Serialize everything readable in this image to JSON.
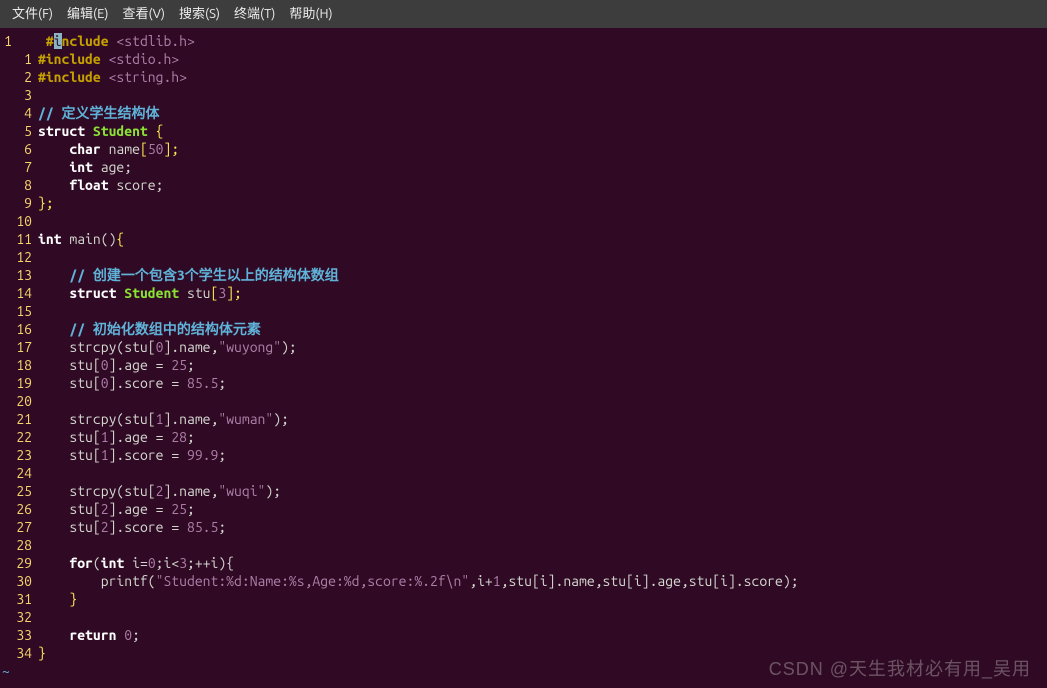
{
  "menu": {
    "file": "文件(F)",
    "edit": "编辑(E)",
    "view": "查看(V)",
    "search": "搜索(S)",
    "terminal": "终端(T)",
    "help": "帮助(H)"
  },
  "watermark": "CSDN @天生我材必有用_吴用",
  "linesCol1": [
    "1",
    "",
    "",
    "",
    "",
    "",
    "",
    "",
    "",
    "",
    "",
    "",
    "",
    "",
    "",
    "",
    "",
    "",
    "",
    "",
    "",
    "",
    "",
    "",
    "",
    "",
    "",
    "",
    "",
    "",
    "",
    "",
    "",
    "",
    ""
  ],
  "linesCol2": [
    "",
    "1",
    "2",
    "3",
    "4",
    "5",
    "6",
    "7",
    "8",
    "9",
    "10",
    "11",
    "12",
    "13",
    "14",
    "15",
    "16",
    "17",
    "18",
    "19",
    "20",
    "21",
    "22",
    "23",
    "24",
    "25",
    "26",
    "27",
    "28",
    "29",
    "30",
    "31",
    "32",
    "33",
    "34"
  ],
  "code": {
    "l0": {
      "pp1": "#",
      "cursor": "i",
      "pp2": "nclude",
      "inc": "<stdlib.h>"
    },
    "l1": {
      "pp": "#include",
      "inc": "<stdio.h>"
    },
    "l2": {
      "pp": "#include",
      "inc": "<string.h>"
    },
    "l4": {
      "cm": "// 定义学生结构体"
    },
    "l5": {
      "kw": "struct",
      "type": "Student",
      "br": "{"
    },
    "l6": {
      "kw": "char",
      "id": "name",
      "br1": "[",
      "num": "50",
      "br2": "];"
    },
    "l7": {
      "kw": "int",
      "id": "age;"
    },
    "l8": {
      "kw": "float",
      "id": "score;"
    },
    "l9": {
      "br": "};"
    },
    "l11": {
      "kw": "int",
      "fn": "main()",
      "br": "{"
    },
    "l13": {
      "cm": "// 创建一个包含3个学生以上的结构体数组"
    },
    "l14": {
      "kw": "struct",
      "type": "Student",
      "id": "stu",
      "br1": "[",
      "num": "3",
      "br2": "];"
    },
    "l16": {
      "cm": "// 初始化数组中的结构体元素"
    },
    "l17": {
      "fn": "strcpy(stu[",
      "num": "0",
      "mid": "].name,",
      "str": "\"wuyong\"",
      "end": ");"
    },
    "l18": {
      "id": "stu[",
      "num": "0",
      "mid": "].age = ",
      "val": "25",
      "end": ";"
    },
    "l19": {
      "id": "stu[",
      "num": "0",
      "mid": "].score = ",
      "val": "85.5",
      "end": ";"
    },
    "l21": {
      "fn": "strcpy(stu[",
      "num": "1",
      "mid": "].name,",
      "str": "\"wuman\"",
      "end": ");"
    },
    "l22": {
      "id": "stu[",
      "num": "1",
      "mid": "].age = ",
      "val": "28",
      "end": ";"
    },
    "l23": {
      "id": "stu[",
      "num": "1",
      "mid": "].score = ",
      "val": "99.9",
      "end": ";"
    },
    "l25": {
      "fn": "strcpy(stu[",
      "num": "2",
      "mid": "].name,",
      "str": "\"wuqi\"",
      "end": ");"
    },
    "l26": {
      "id": "stu[",
      "num": "2",
      "mid": "].age = ",
      "val": "25",
      "end": ";"
    },
    "l27": {
      "id": "stu[",
      "num": "2",
      "mid": "].score = ",
      "val": "85.5",
      "end": ";"
    },
    "l29": {
      "kw": "for",
      "a": "(",
      "kw2": "int",
      "b": " i=",
      "n0": "0",
      "c": ";i<",
      "n1": "3",
      "d": ";++i){"
    },
    "l30": {
      "fn": "printf(",
      "str": "\"Student:%d:Name:%s,Age:%d,score:%.2f\\n\"",
      "rest": ",i+",
      "n": "1",
      "rest2": ",stu[i].name,stu[i].age,stu[i].score);"
    },
    "l31": {
      "br": "}"
    },
    "l33": {
      "kw": "return",
      "num": "0",
      "end": ";"
    },
    "l34": {
      "br": "}"
    }
  }
}
